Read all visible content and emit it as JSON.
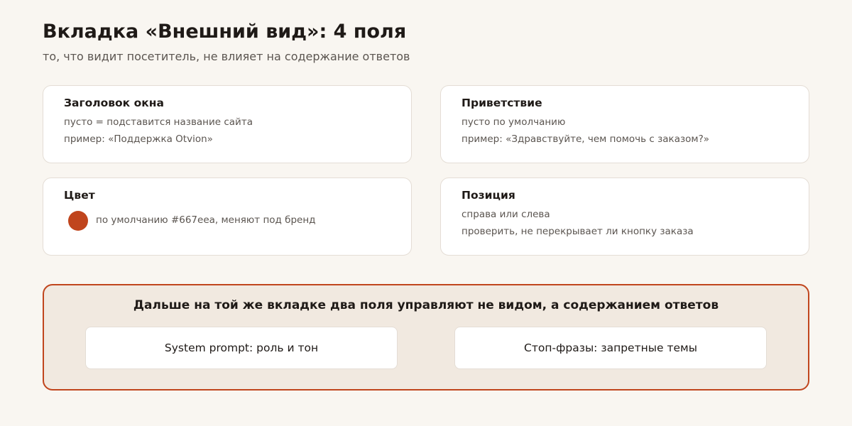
{
  "header": {
    "title": "Вкладка «Внешний вид»: 4 поля",
    "subtitle": "то, что видит посетитель, не влияет на содержание ответов"
  },
  "fields": {
    "window_title": {
      "label": "Заголовок окна",
      "line1": "пусто = подставится название сайта",
      "line2": "пример: «Поддержка Otvion»"
    },
    "greeting": {
      "label": "Приветствие",
      "line1": "пусто по умолчанию",
      "line2": "пример: «Здравствуйте, чем помочь с заказом?»"
    },
    "color": {
      "label": "Цвет",
      "line1": "по умолчанию #667eea, меняют под бренд",
      "swatch_color": "#c0451d"
    },
    "position": {
      "label": "Позиция",
      "line1": "справа или слева",
      "line2": "проверить, не перекрывает ли кнопку заказа"
    }
  },
  "next_section": {
    "title": "Дальше на той же вкладке два поля управляют не видом, а содержанием ответов",
    "items": [
      "System prompt: роль и тон",
      "Стоп-фразы: запретные темы"
    ]
  },
  "colors": {
    "background": "#f9f6f1",
    "accent": "#c0451d",
    "card_border": "#e4ddd5",
    "panel": "#f1e9e0"
  }
}
